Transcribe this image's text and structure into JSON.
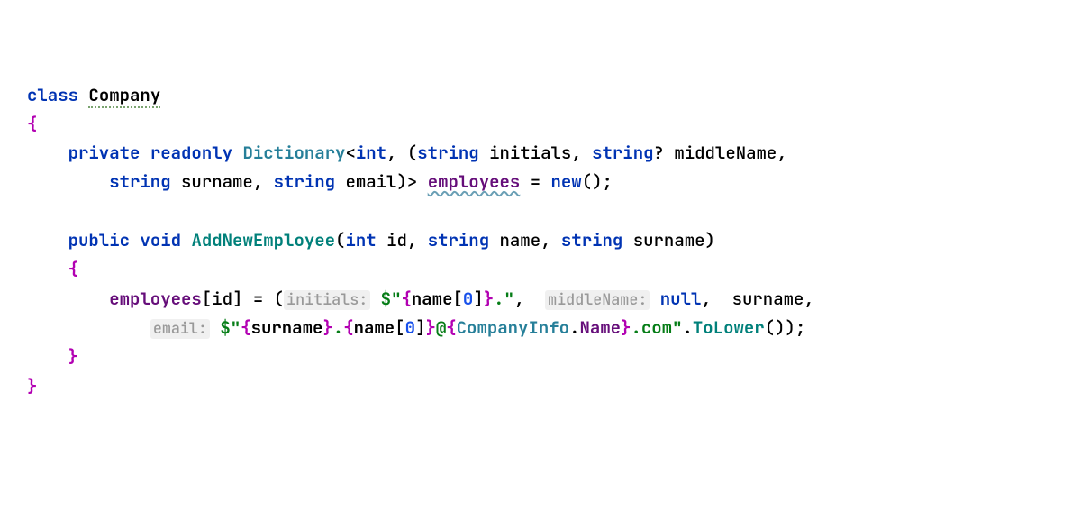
{
  "code": {
    "l1_class": "class",
    "l1_name": "Company",
    "l2_brace": "{",
    "l3_private": "private",
    "l3_readonly": "readonly",
    "l3_dict": "Dictionary",
    "l3_lt": "<",
    "l3_int": "int",
    "l3_comma1": ", ",
    "l3_paren": "(",
    "l3_string1": "string",
    "l3_initials": "initials",
    "l3_comma2": ", ",
    "l3_string2": "string",
    "l3_q": "?",
    "l3_middlename": "middleName",
    "l3_comma3": ",",
    "l4_string1": "string",
    "l4_surname": "surname",
    "l4_comma1": ", ",
    "l4_string2": "string",
    "l4_email": "email",
    "l4_rparen": ")",
    "l4_gt": ">",
    "l4_employees": "employees",
    "l4_eq": " = ",
    "l4_new": "new",
    "l4_parens": "()",
    "l4_semi": ";",
    "l5_public": "public",
    "l5_void": "void",
    "l5_method": "AddNewEmployee",
    "l5_lparen": "(",
    "l5_int": "int",
    "l5_id": "id",
    "l5_comma1": ", ",
    "l5_string1": "string",
    "l5_name": "name",
    "l5_comma2": ", ",
    "l5_string2": "string",
    "l5_surname": "surname",
    "l5_rparen": ")",
    "l6_brace": "{",
    "l7_employees": "employees",
    "l7_lbracket": "[",
    "l7_id": "id",
    "l7_rbracket": "]",
    "l7_eq": " = ",
    "l7_lparen": "(",
    "l7_hint_initials": "initials:",
    "l7_dollar1": "$",
    "l7_q1": "\"",
    "l7_lb1": "{",
    "l7_name1": "name",
    "l7_lbr1": "[",
    "l7_zero1": "0",
    "l7_rbr1": "]",
    "l7_rb1": "}",
    "l7_dot": ".",
    "l7_q2": "\"",
    "l7_comma1": ",  ",
    "l7_hint_middle": "middleName:",
    "l7_null": "null",
    "l7_comma2": ",  ",
    "l7_surname": "surname",
    "l7_comma3": ",",
    "l8_hint_email": "email:",
    "l8_dollar": "$",
    "l8_q1": "\"",
    "l8_lb1": "{",
    "l8_surname": "surname",
    "l8_rb1": "}",
    "l8_dot1": ".",
    "l8_lb2": "{",
    "l8_name": "name",
    "l8_lbr": "[",
    "l8_zero": "0",
    "l8_rbr": "]",
    "l8_rb2": "}",
    "l8_at": "@",
    "l8_lb3": "{",
    "l8_ci": "CompanyInfo",
    "l8_dot2": ".",
    "l8_ciname": "Name",
    "l8_rb3": "}",
    "l8_com": ".com",
    "l8_q2": "\"",
    "l8_dot3": ".",
    "l8_tolower": "ToLower",
    "l8_parens": "()",
    "l8_rparen": ")",
    "l8_semi": ";",
    "l9_brace": "}",
    "l10_brace": "}"
  }
}
